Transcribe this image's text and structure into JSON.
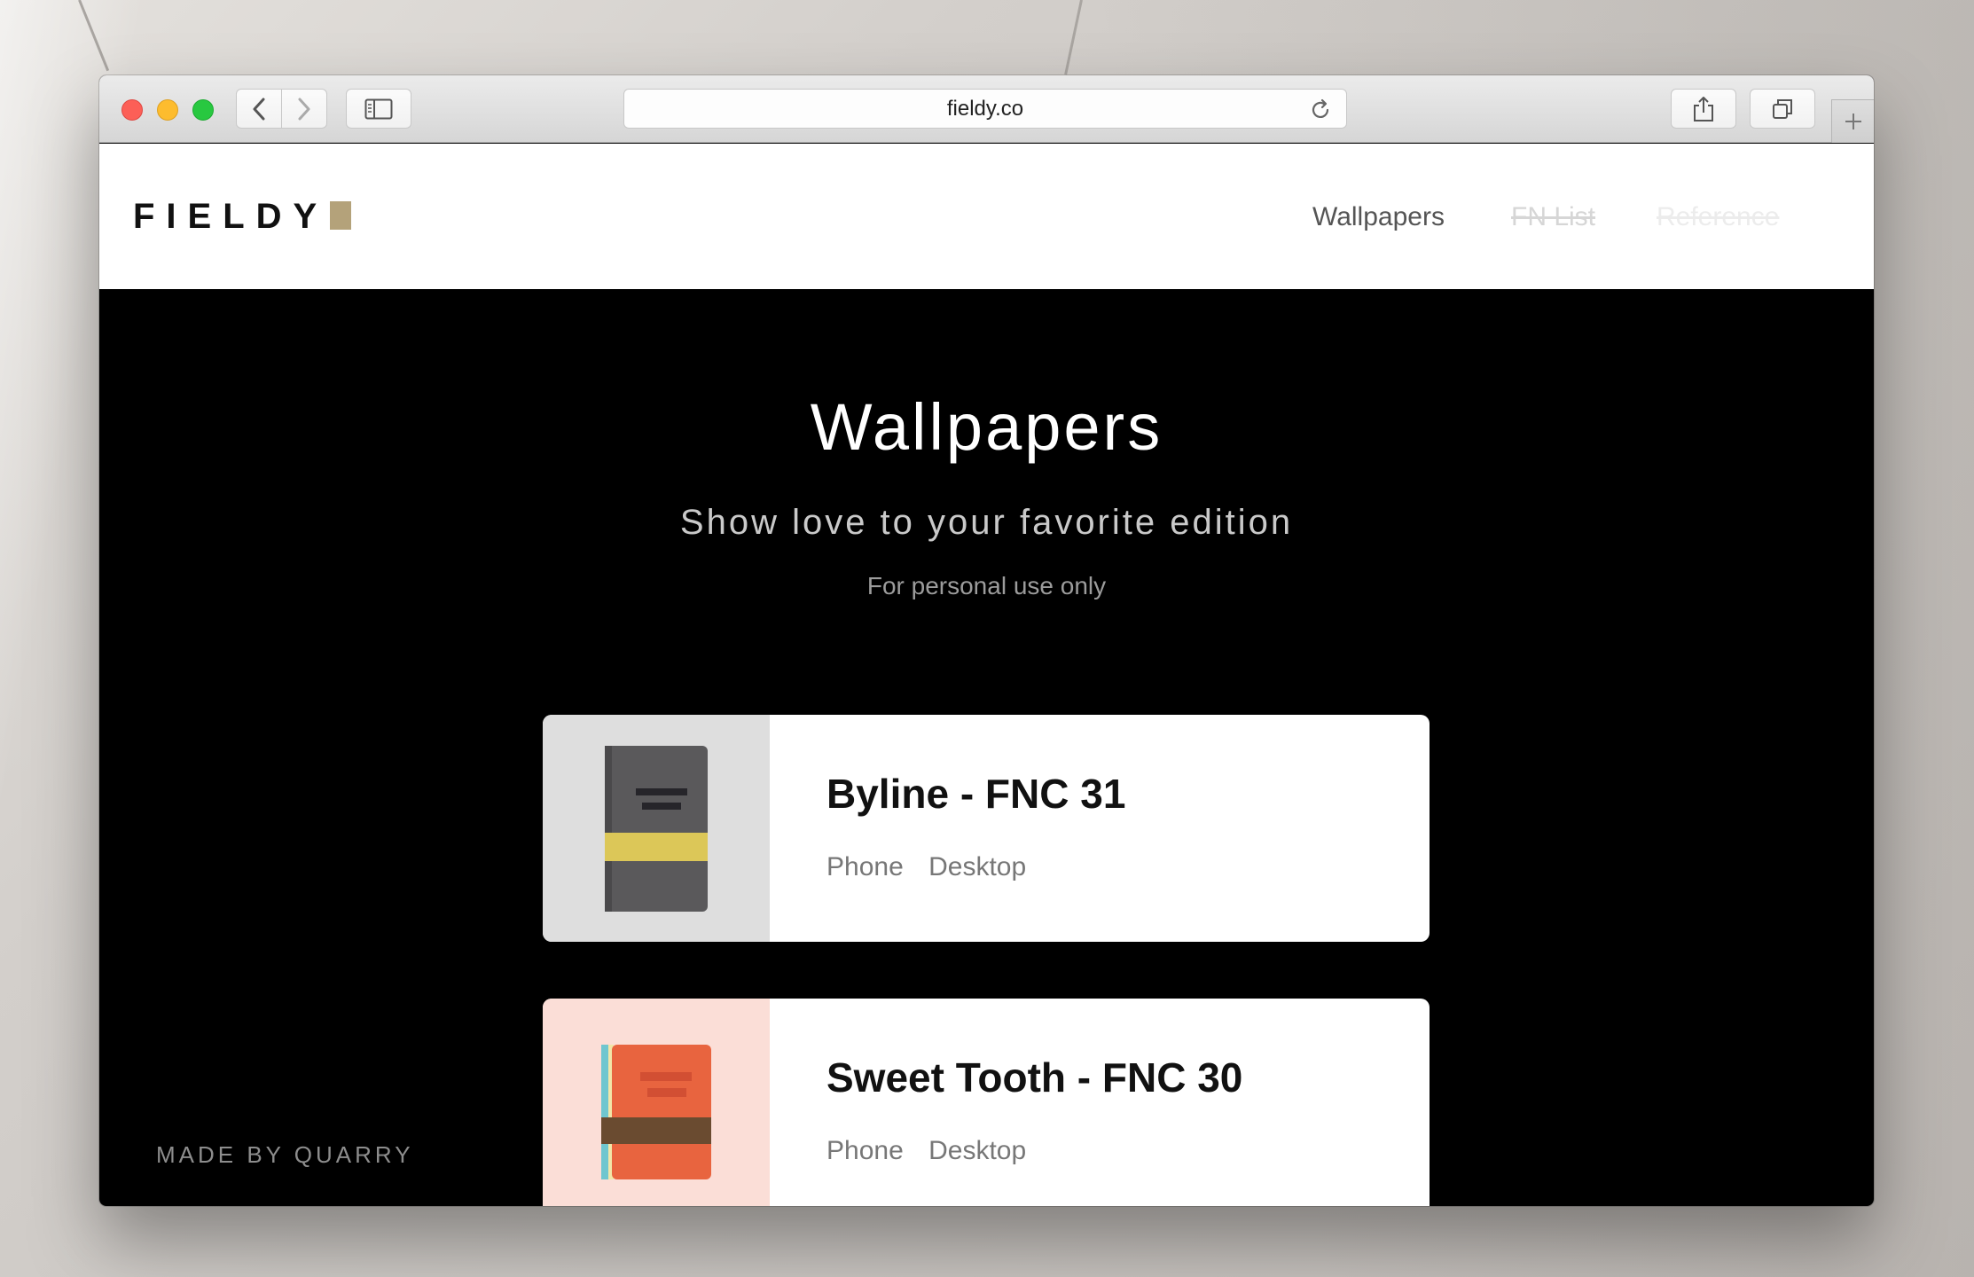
{
  "browser": {
    "url": "fieldy.co"
  },
  "site": {
    "logo_text": "FIELDY",
    "nav": {
      "wallpapers": "Wallpapers",
      "fn_list": "FN List",
      "reference": "Reference"
    }
  },
  "hero": {
    "title": "Wallpapers",
    "subtitle": "Show love to your favorite edition",
    "note": "For personal use only"
  },
  "editions": [
    {
      "title": "Byline - FNC 31",
      "phone": "Phone",
      "desktop": "Desktop",
      "thumb_bg": "#dedede",
      "book_color": "#5a595b",
      "band_color": "#dcc758"
    },
    {
      "title": "Sweet Tooth - FNC 30",
      "phone": "Phone",
      "desktop": "Desktop",
      "thumb_bg": "#fbded7",
      "book_color": "#e8643f",
      "band_color": "#6a4b30"
    }
  ],
  "footer": {
    "credit": "MADE BY QUARRY"
  },
  "colors": {
    "logo_mark": "#b4a27a",
    "page_bg": "#000000"
  }
}
